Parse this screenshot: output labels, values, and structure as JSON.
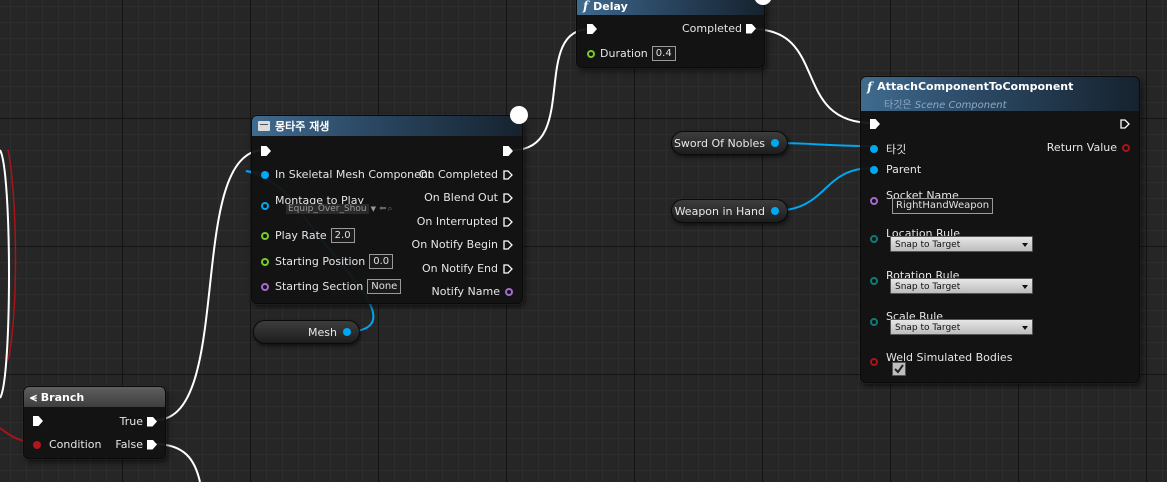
{
  "delay": {
    "title": "Delay",
    "completed": "Completed",
    "duration_label": "Duration",
    "duration_value": "0.4"
  },
  "attach": {
    "title": "AttachComponentToComponent",
    "subtitle_prefix": "타깃은",
    "subtitle_type": "Scene Component",
    "target": "타깃",
    "parent": "Parent",
    "return_value": "Return Value",
    "socket_name_label": "Socket Name",
    "socket_name_value": "RightHandWeapon",
    "location_rule_label": "Location Rule",
    "location_rule_value": "Snap to Target",
    "rotation_rule_label": "Rotation Rule",
    "rotation_rule_value": "Snap to Target",
    "scale_rule_label": "Scale Rule",
    "scale_rule_value": "Snap to Target",
    "weld_label": "Weld Simulated Bodies",
    "weld_checked": true
  },
  "montage": {
    "title": "몽타주 재생",
    "in_skeletal": "In Skeletal Mesh Component",
    "montage_to_play": "Montage to Play",
    "montage_value": "Equip_Over_Shou",
    "play_rate": "Play Rate",
    "play_rate_value": "2.0",
    "starting_position": "Starting Position",
    "starting_position_value": "0.0",
    "starting_section": "Starting Section",
    "starting_section_value": "None",
    "on_completed": "On Completed",
    "on_blend_out": "On Blend Out",
    "on_interrupted": "On Interrupted",
    "on_notify_begin": "On Notify Begin",
    "on_notify_end": "On Notify End",
    "notify_name": "Notify Name"
  },
  "vars": {
    "sword": "Sword Of Nobles",
    "weapon": "Weapon in Hand",
    "mesh": "Mesh"
  },
  "branch": {
    "title": "Branch",
    "true": "True",
    "false": "False",
    "condition": "Condition"
  },
  "colors": {
    "exec": "#ffffff",
    "object": "#00a8f3",
    "float": "#7ac92a",
    "name": "#a36cd1",
    "enum": "#0f7a74",
    "bool": "#a81418",
    "header": "#3f6b8f"
  }
}
